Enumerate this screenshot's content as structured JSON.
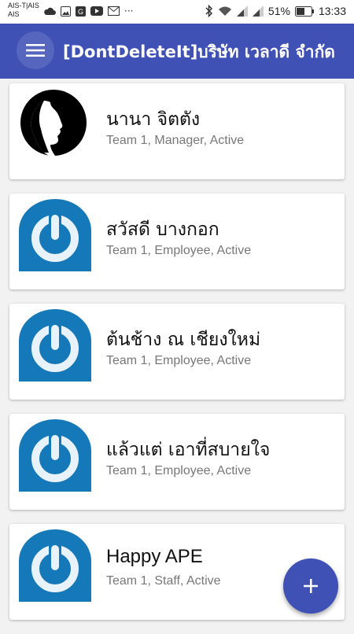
{
  "status_bar": {
    "carrier_line1": "AIS-T|AIS",
    "carrier_line2": "AIS",
    "more": "···",
    "battery": "51%",
    "time": "13:33"
  },
  "app_bar": {
    "title": "[DontDeleteIt]บริษัท เวลาดี จำกัด",
    "accent_color": "#3f51b5"
  },
  "employees": [
    {
      "name": "นานา จิตตัง",
      "details": "Team 1, Manager, Active",
      "avatar": "woman-silhouette-icon"
    },
    {
      "name": "สวัสดี บางกอก",
      "details": "Team 1, Employee, Active",
      "avatar": "power-logo-icon"
    },
    {
      "name": "ต้นช้าง ณ เชียงใหม่",
      "details": "Team 1, Employee, Active",
      "avatar": "power-logo-icon"
    },
    {
      "name": "แล้วแต่ เอาที่สบายใจ",
      "details": "Team 1, Employee, Active",
      "avatar": "power-logo-icon"
    },
    {
      "name": "Happy APE",
      "details": "Team 1, Staff, Active",
      "avatar": "power-logo-icon"
    }
  ],
  "fab": {
    "label": "+"
  }
}
